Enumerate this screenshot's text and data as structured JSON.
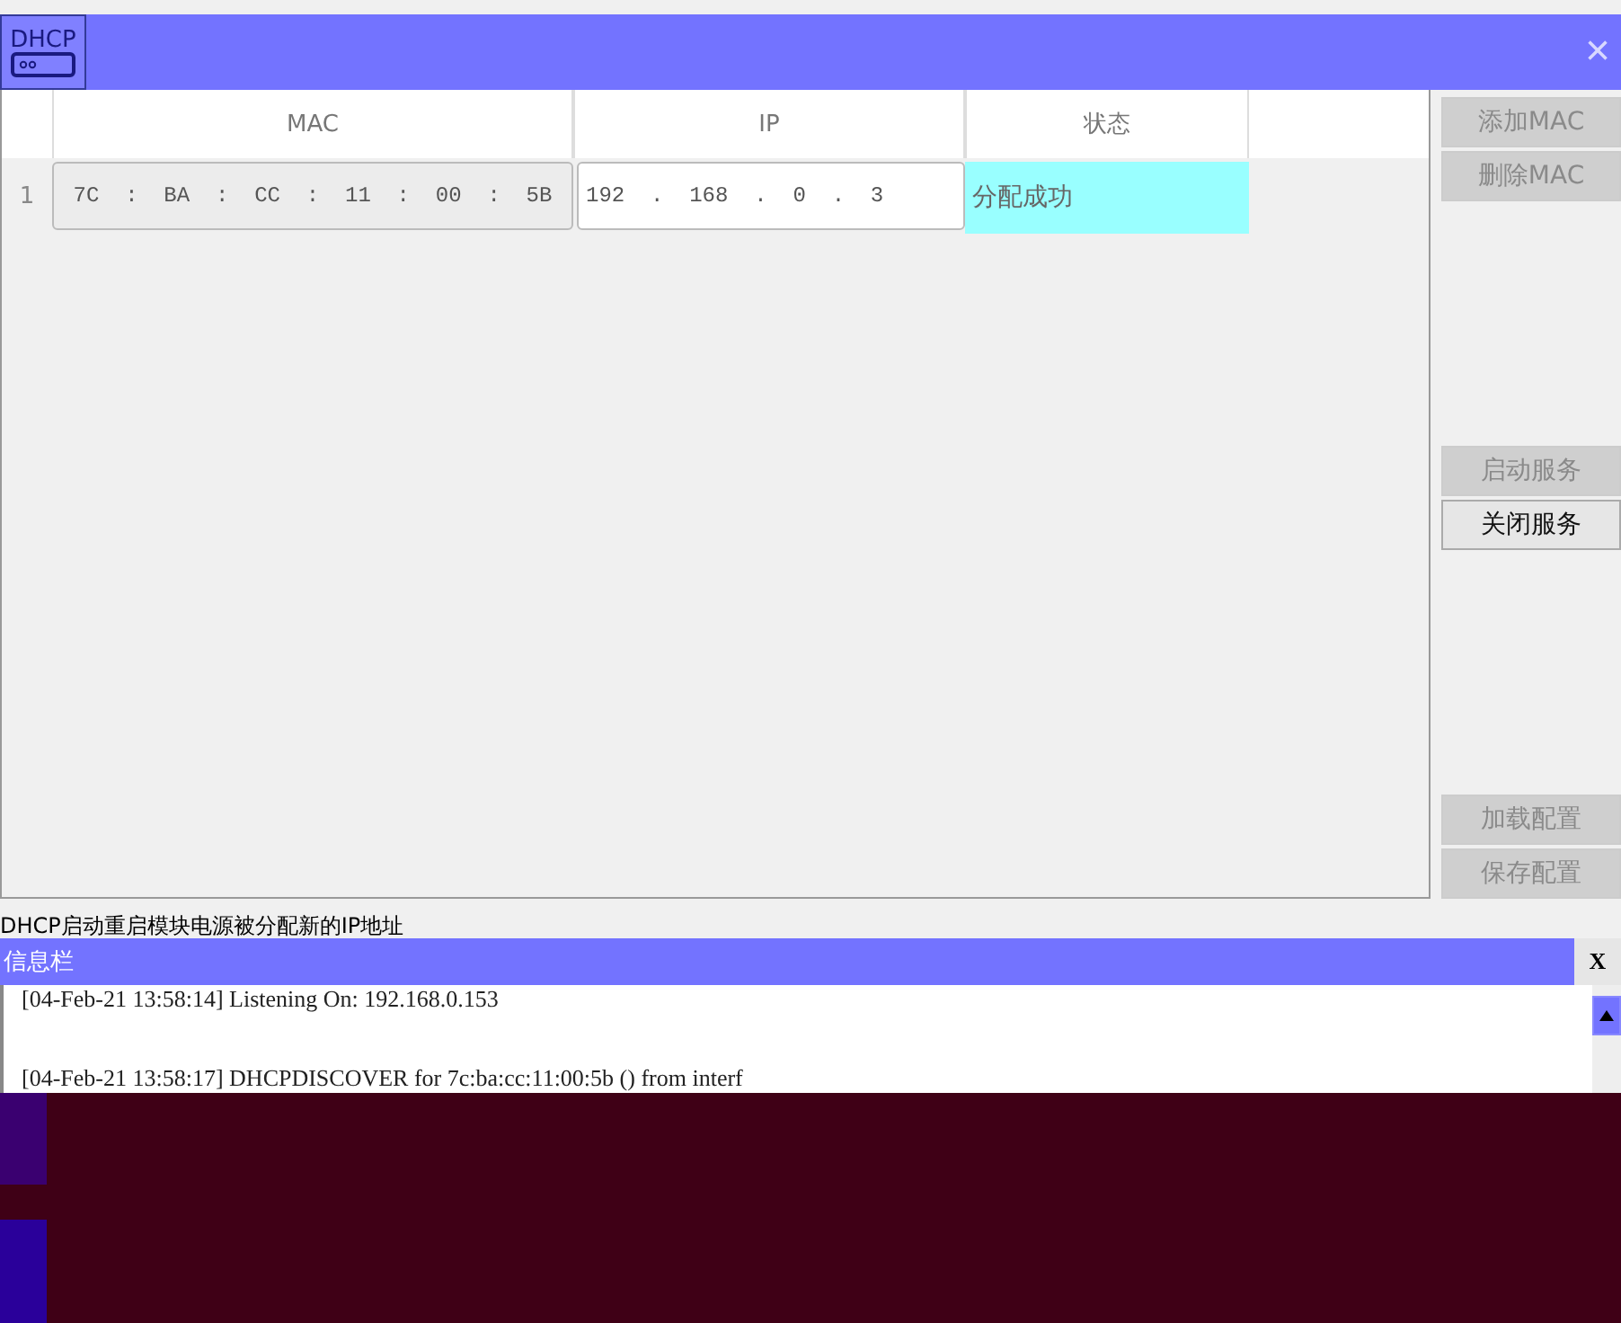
{
  "window": {
    "logo": "DHCP",
    "close": "×"
  },
  "table": {
    "columns": [
      "MAC",
      "IP",
      "状态"
    ],
    "rows": [
      {
        "index": "1",
        "mac": "7C  :  BA  :  CC  :  11  :  00  :  5B",
        "ip": "192  .  168  .  0  .  3",
        "status": "分配成功"
      }
    ]
  },
  "button_groups": [
    [
      {
        "label": "添加MAC",
        "disabled": true
      },
      {
        "label": "删除MAC",
        "disabled": true
      }
    ],
    [
      {
        "label": "启动服务",
        "disabled": true
      },
      {
        "label": "关闭服务",
        "disabled": false
      }
    ],
    [
      {
        "label": "加载配置",
        "disabled": true
      },
      {
        "label": "保存配置",
        "disabled": true
      }
    ]
  ],
  "status_bar": "DHCP启动重启模块电源被分配新的IP地址",
  "info_panel": {
    "title": "信息栏",
    "close": "X",
    "log": [
      "[04-Feb-21 13:58:14] Listening On: 192.168.0.153",
      "[04-Feb-21 13:58:17] DHCPDISCOVER for 7c:ba:cc:11:00:5b () from interf"
    ]
  }
}
